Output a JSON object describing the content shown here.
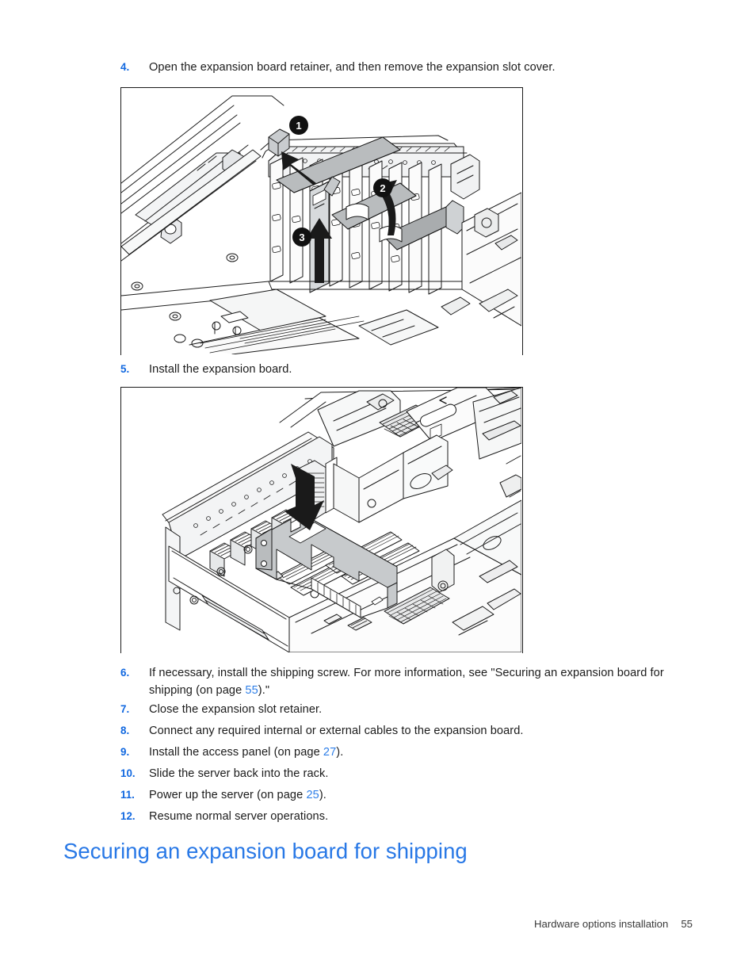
{
  "document": {
    "footer_section": "Hardware options installation",
    "footer_page": "55"
  },
  "steps": [
    {
      "number": "4.",
      "text": "Open the expansion board retainer, and then remove the expansion slot cover."
    },
    {
      "number": "5.",
      "text": "Install the expansion board."
    },
    {
      "number": "6.",
      "text_before": "If necessary, install the shipping screw. For more information, see \"Securing an expansion board for shipping (on page ",
      "link": "55",
      "text_after": ").\""
    },
    {
      "number": "7.",
      "text": "Close the expansion slot retainer."
    },
    {
      "number": "8.",
      "text": "Connect any required internal or external cables to the expansion board."
    },
    {
      "number": "9.",
      "text_before": "Install the access panel (on page ",
      "link": "27",
      "text_after": ")."
    },
    {
      "number": "10.",
      "text": "Slide the server back into the rack."
    },
    {
      "number": "11.",
      "text_before": "Power up the server (on page ",
      "link": "25",
      "text_after": ")."
    },
    {
      "number": "12.",
      "text": "Resume normal server operations."
    }
  ],
  "figures": {
    "figure_1": {
      "caption_step": "4",
      "description": "Server chassis interior showing expansion board retainer and expansion slot cover removal",
      "callouts": [
        {
          "label": "1",
          "meaning": "release-retainer-latch"
        },
        {
          "label": "2",
          "meaning": "rotate-retainer-open"
        },
        {
          "label": "3",
          "meaning": "lift-out-slot-cover"
        }
      ]
    },
    "figure_2": {
      "caption_step": "5",
      "description": "Server chassis interior showing expansion board being lowered into the PCI slot",
      "callouts": []
    }
  },
  "heading": {
    "title": "Securing an expansion board for shipping"
  },
  "colors": {
    "link_blue": "#2f7fe8",
    "number_blue": "#1168e0",
    "heading_blue": "#2878e6",
    "line_art": "#1a1a1a",
    "fill_gray": "#b9bcbe",
    "fill_light": "#dcdfe1",
    "callout_bg": "#111111"
  }
}
